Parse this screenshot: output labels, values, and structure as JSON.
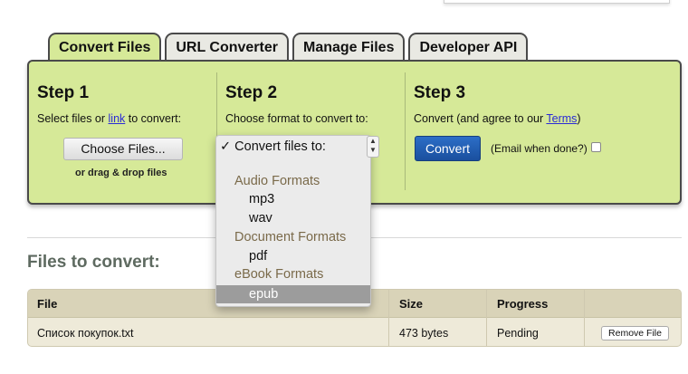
{
  "tabs": [
    {
      "label": "Convert Files",
      "active": true
    },
    {
      "label": "URL Converter",
      "active": false
    },
    {
      "label": "Manage Files",
      "active": false
    },
    {
      "label": "Developer API",
      "active": false
    }
  ],
  "step1": {
    "title": "Step 1",
    "desc_prefix": "Select files or ",
    "desc_link": "link",
    "desc_suffix": " to convert:",
    "choose_button": "Choose Files...",
    "drag_text": "or drag & drop files"
  },
  "step2": {
    "title": "Step 2",
    "desc": "Choose format to convert to:",
    "dropdown": {
      "selected": "✓ Convert files to:",
      "groups": [
        {
          "label": "Audio Formats",
          "options": [
            "mp3",
            "wav"
          ]
        },
        {
          "label": "Document Formats",
          "options": [
            "pdf"
          ]
        },
        {
          "label": "eBook Formats",
          "options": [
            "epub"
          ]
        }
      ],
      "highlighted": "epub"
    }
  },
  "step3": {
    "title": "Step 3",
    "desc_prefix": "Convert (and agree to our ",
    "desc_link": "Terms",
    "desc_suffix": ")",
    "convert_button": "Convert",
    "email_label": "(Email when done?)"
  },
  "files": {
    "title": "Files to convert:",
    "columns": [
      "File",
      "Size",
      "Progress",
      ""
    ],
    "rows": [
      {
        "file": "Список покупок.txt",
        "size": "473 bytes",
        "progress": "Pending",
        "action": "Remove File"
      }
    ]
  },
  "colors": {
    "panel": "#d6e998",
    "convert_button": "#1f5bb0",
    "table_header": "#d9d3b8"
  }
}
